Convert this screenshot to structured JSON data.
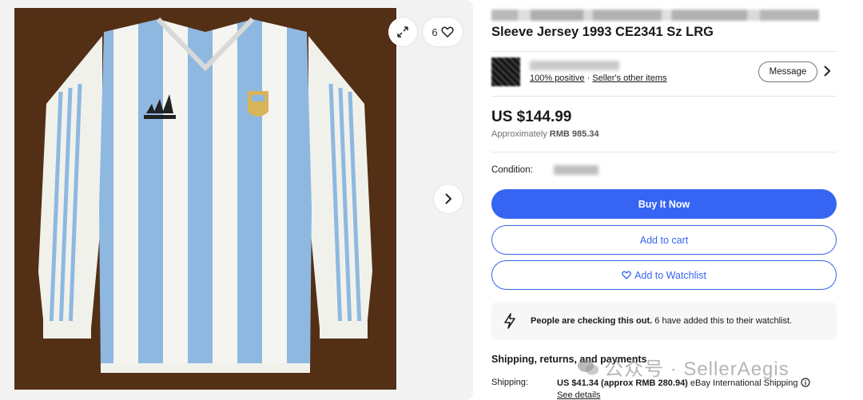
{
  "gallery": {
    "watch_count": "6"
  },
  "item": {
    "title_line2": "Sleeve Jersey 1993 CE2341 Sz LRG"
  },
  "seller": {
    "positive": "100% positive",
    "separator": "·",
    "other_items": "Seller's other items",
    "message_label": "Message"
  },
  "price": {
    "main": "US $144.99",
    "approx_label": "Approximately",
    "approx_value": "RMB 985.34"
  },
  "condition": {
    "label": "Condition:"
  },
  "actions": {
    "buy_now": "Buy It Now",
    "add_to_cart": "Add to cart",
    "add_to_watchlist": "Add to Watchlist"
  },
  "notice": {
    "bold": "People are checking this out.",
    "rest": " 6 have added this to their watchlist."
  },
  "shipping": {
    "heading": "Shipping, returns, and payments",
    "label": "Shipping:",
    "value_bold": "US $41.34 (approx RMB 280.94)",
    "value_rest": " eBay International Shipping",
    "see_details": "See details"
  },
  "watermark": {
    "text": "公众号 · SellerAegis"
  },
  "colors": {
    "primary_blue": "#3665f3",
    "jersey_blue": "#8eb8e0",
    "background_brown": "#5a3418"
  },
  "icons": [
    "expand-icon",
    "heart-icon",
    "chevron-right-icon",
    "lightning-icon",
    "info-icon",
    "wechat-icon"
  ]
}
